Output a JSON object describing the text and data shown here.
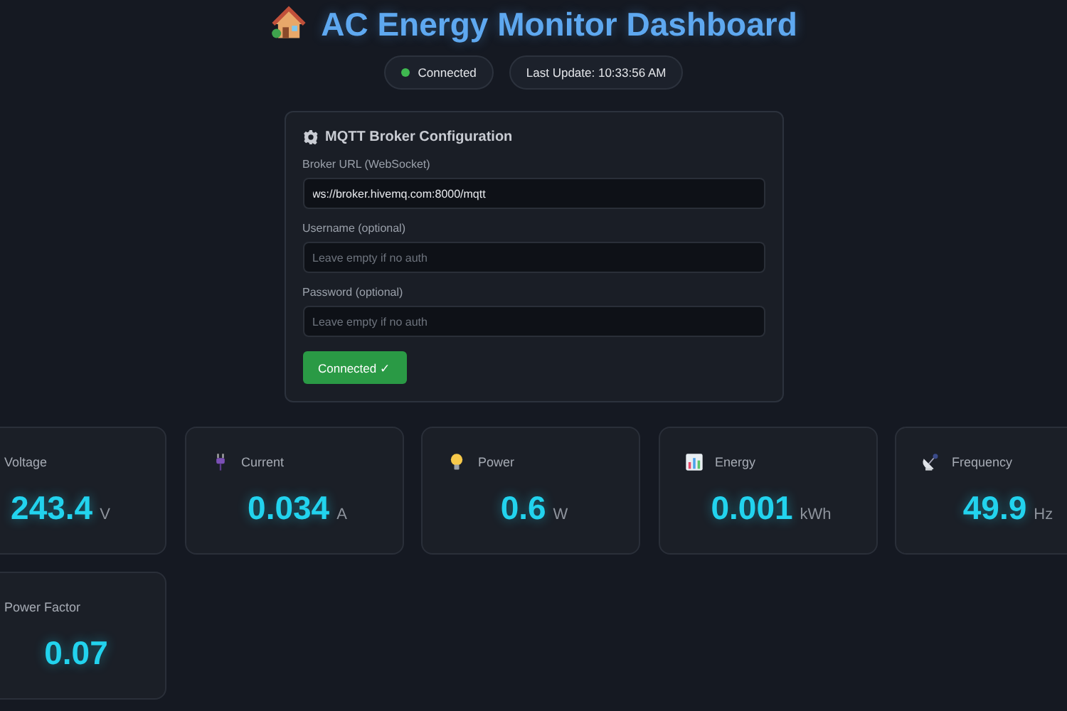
{
  "header": {
    "title": "AC Energy Monitor Dashboard"
  },
  "status": {
    "connection": "Connected",
    "connected": true,
    "last_update": "Last Update: 10:33:56 AM"
  },
  "config": {
    "title": "MQTT Broker Configuration",
    "fields": [
      {
        "label": "Broker URL (WebSocket)",
        "value": "ws://broker.hivemq.com:8000/mqtt"
      },
      {
        "label": "Username (optional)",
        "placeholder": "Leave empty if no auth"
      },
      {
        "label": "Password (optional)",
        "placeholder": "Leave empty if no auth"
      }
    ],
    "button": {
      "label": "Connected ✓",
      "connected": true
    }
  },
  "metrics": [
    {
      "kind": "voltage",
      "label": "Voltage",
      "value": "243.4",
      "unit": "V"
    },
    {
      "kind": "current",
      "label": "Current",
      "value": "0.034",
      "unit": "A"
    },
    {
      "kind": "power",
      "label": "Power",
      "value": "0.6",
      "unit": "W"
    },
    {
      "kind": "energy",
      "label": "Energy",
      "value": "0.001",
      "unit": "kWh"
    },
    {
      "kind": "frequency",
      "label": "Frequency",
      "value": "49.9",
      "unit": "Hz"
    },
    {
      "kind": "power_factor",
      "label": "Power Factor",
      "value": "0.07"
    }
  ]
}
